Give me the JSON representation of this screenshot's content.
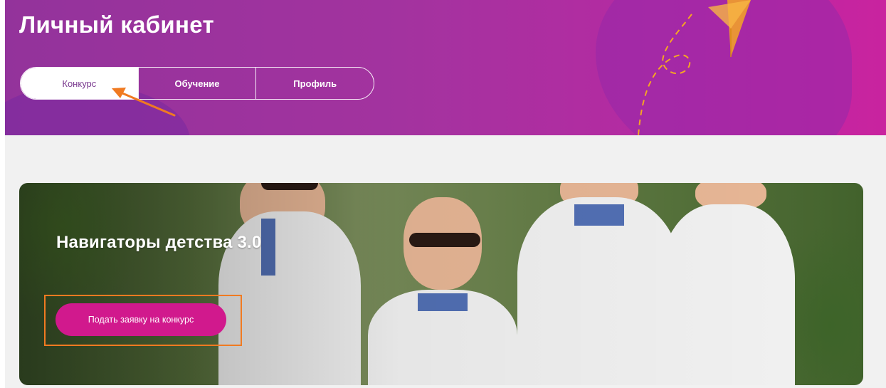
{
  "header": {
    "title": "Личный кабинет",
    "tabs": [
      {
        "label": "Конкурс",
        "active": true
      },
      {
        "label": "Обучение",
        "active": false
      },
      {
        "label": "Профиль",
        "active": false
      }
    ]
  },
  "banner": {
    "title": "Навигаторы детства 3.0",
    "cta_label": "Подать заявку на конкурс"
  },
  "colors": {
    "header_gradient_start": "#93339b",
    "header_gradient_end": "#c9239f",
    "cta_button": "#d1198d",
    "annotation": "#f07a21",
    "deco_accent": "#f5a623"
  },
  "icons": {
    "annotation_arrow": "arrow-icon",
    "paper_plane": "paper-plane-icon"
  }
}
